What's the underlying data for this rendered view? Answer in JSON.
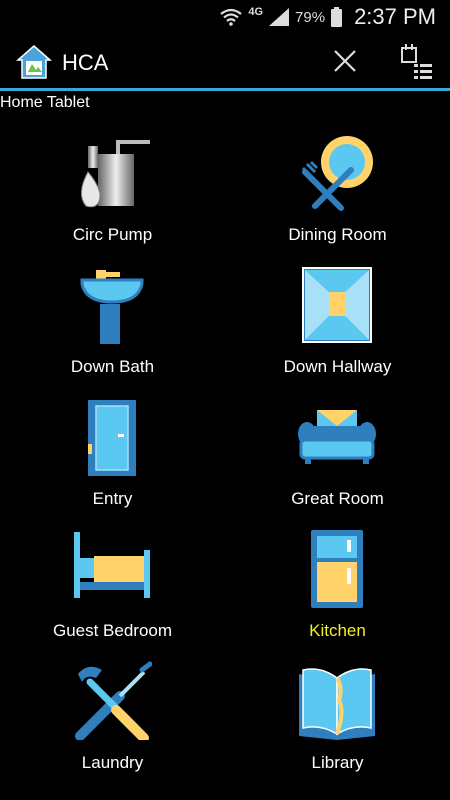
{
  "status_bar": {
    "network": "4G",
    "battery_percent": "79%",
    "time": "2:37 PM",
    "icons": [
      "wifi-icon",
      "signal-icon",
      "battery-icon"
    ]
  },
  "app_bar": {
    "title": "HCA",
    "logo": "house-logo-icon",
    "actions": [
      "close-icon",
      "schedule-list-icon"
    ],
    "accent_color": "#36a9d8"
  },
  "subheader": "Home Tablet",
  "rooms": [
    {
      "label": "Circ Pump",
      "icon": "circ-pump-icon",
      "selected": false
    },
    {
      "label": "Dining Room",
      "icon": "dining-room-icon",
      "selected": false
    },
    {
      "label": "Down Bath",
      "icon": "down-bath-icon",
      "selected": false
    },
    {
      "label": "Down Hallway",
      "icon": "down-hallway-icon",
      "selected": false
    },
    {
      "label": "Entry",
      "icon": "entry-door-icon",
      "selected": false
    },
    {
      "label": "Great Room",
      "icon": "great-room-sofa-icon",
      "selected": false
    },
    {
      "label": "Guest Bedroom",
      "icon": "guest-bedroom-bed-icon",
      "selected": false
    },
    {
      "label": "Kitchen",
      "icon": "kitchen-fridge-icon",
      "selected": true
    },
    {
      "label": "Laundry",
      "icon": "laundry-tools-icon",
      "selected": false
    },
    {
      "label": "Library",
      "icon": "library-book-icon",
      "selected": false
    }
  ],
  "colors": {
    "background": "#000000",
    "label": "#ffffff",
    "selected_label": "#f4ee2a",
    "icon_blue": "#2f7fbf",
    "icon_light_blue": "#5bc8f2",
    "icon_yellow": "#ffd36a"
  }
}
